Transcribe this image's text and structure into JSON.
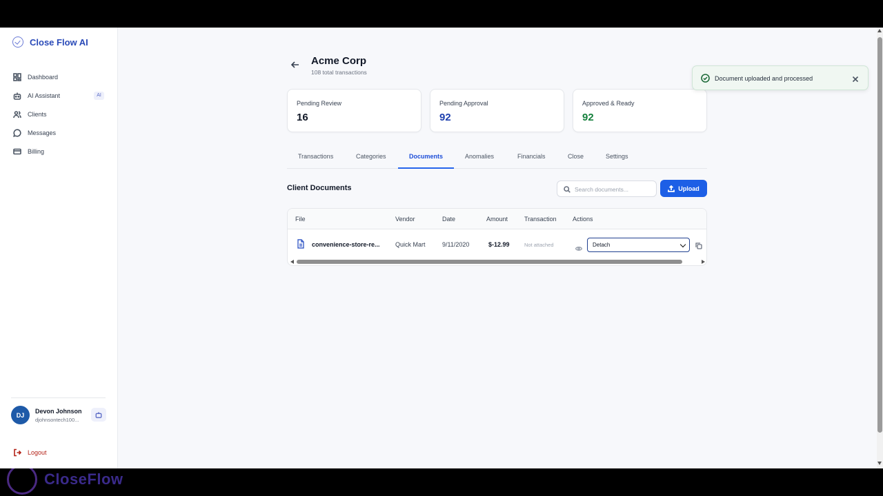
{
  "brand": {
    "name": "Close Flow AI"
  },
  "sidebar": {
    "items": [
      {
        "label": "Dashboard",
        "icon": "dashboard-icon"
      },
      {
        "label": "AI Assistant",
        "icon": "bot-icon",
        "badge": "AI"
      },
      {
        "label": "Clients",
        "icon": "users-icon"
      },
      {
        "label": "Messages",
        "icon": "message-icon"
      },
      {
        "label": "Billing",
        "icon": "card-icon"
      }
    ],
    "user": {
      "initials": "DJ",
      "name": "Devon Johnson",
      "email": "djohnsontech100..."
    },
    "logout": "Logout"
  },
  "client": {
    "name": "Acme Corp",
    "subtitle": "108 total transactions"
  },
  "stats": [
    {
      "label": "Pending Review",
      "value": "16",
      "color": "#111827"
    },
    {
      "label": "Pending Approval",
      "value": "92",
      "color": "#1e40af"
    },
    {
      "label": "Approved & Ready",
      "value": "92",
      "color": "#15803d"
    }
  ],
  "tabs": [
    "Transactions",
    "Categories",
    "Documents",
    "Anomalies",
    "Financials",
    "Close",
    "Settings"
  ],
  "active_tab": "Documents",
  "documents": {
    "title": "Client Documents",
    "search_placeholder": "Search documents...",
    "upload_label": "Upload",
    "columns": [
      "File",
      "Vendor",
      "Date",
      "Amount",
      "Transaction",
      "Actions"
    ],
    "rows": [
      {
        "file": "convenience-store-re...",
        "vendor": "Quick Mart",
        "date": "9/11/2020",
        "amount": "$-12.99",
        "transaction": "Not attached",
        "action_selected": "Detach"
      }
    ]
  },
  "toast": {
    "message": "Document uploaded and processed"
  },
  "watermark": {
    "text": "CloseFlow"
  },
  "colors": {
    "accent": "#1d5fe6",
    "brand": "#2a4ab8",
    "success": "#15803d",
    "danger": "#b42318"
  }
}
